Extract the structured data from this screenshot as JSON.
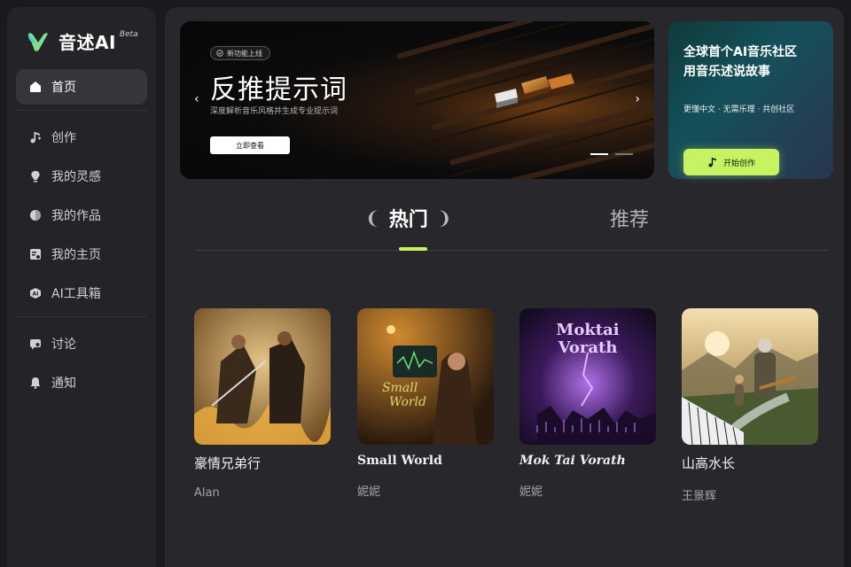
{
  "app": {
    "name": "音述AI",
    "beta": "Beta"
  },
  "sidebar": {
    "items": [
      {
        "label": "首页",
        "icon": "home-icon",
        "active": true
      },
      {
        "label": "创作",
        "icon": "music-note-icon"
      },
      {
        "label": "我的灵感",
        "icon": "bulb-icon"
      },
      {
        "label": "我的作品",
        "icon": "disc-icon"
      },
      {
        "label": "我的主页",
        "icon": "profile-icon"
      },
      {
        "label": "AI工具箱",
        "icon": "ai-toolbox-icon"
      }
    ],
    "secondary": [
      {
        "label": "讨论",
        "icon": "chat-icon"
      },
      {
        "label": "通知",
        "icon": "bell-icon"
      }
    ]
  },
  "banner": {
    "tag": "新功能上线",
    "title": "反推提示词",
    "subtitle": "深度解析音乐风格并生成专业提示词",
    "button": "立即查看",
    "prev": "‹",
    "next": "›"
  },
  "promo": {
    "title_line1": "全球首个AI音乐社区",
    "title_line2": "用音乐述说故事",
    "subtitle": "更懂中文 · 无需乐理 · 共创社区",
    "button": "开始创作"
  },
  "tabs": {
    "hot": "热门",
    "recommend": "推荐"
  },
  "songs": [
    {
      "title": "豪情兄弟行",
      "author": "Alan"
    },
    {
      "title": "Small World",
      "author": "妮妮",
      "cover_text_1": "Small",
      "cover_text_2": "World"
    },
    {
      "title": "Mok Tai Vorath",
      "author": "妮妮",
      "cover_text_1": "Moktai",
      "cover_text_2": "Vorath"
    },
    {
      "title": "山高水长",
      "author": "王景辉"
    }
  ],
  "colors": {
    "accent": "#c7f262",
    "background": "#1a191e",
    "panel": "#28272c",
    "sidebar": "#242328"
  }
}
